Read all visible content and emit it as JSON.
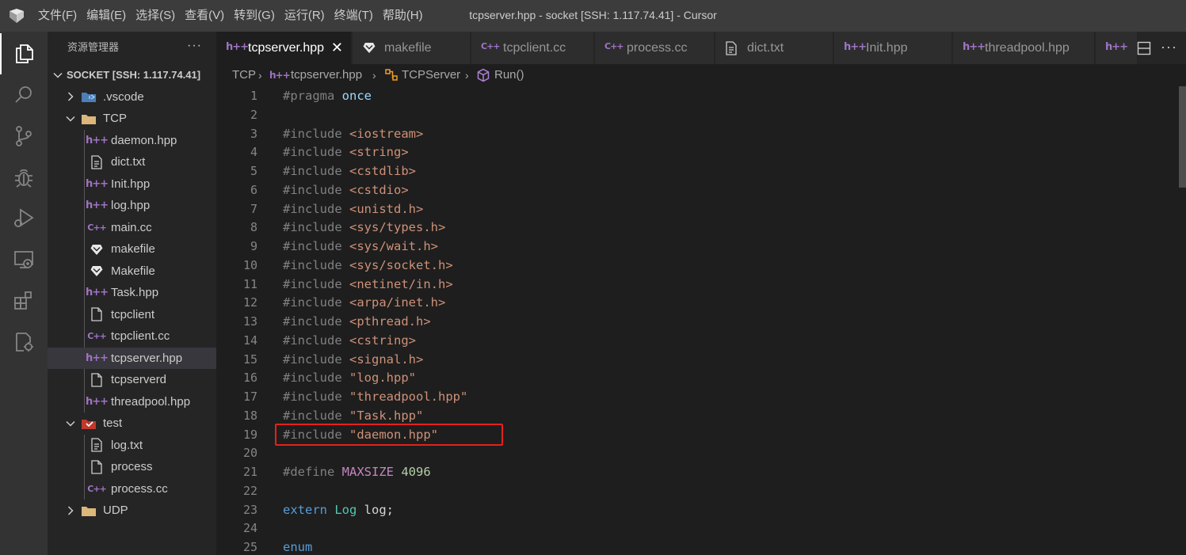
{
  "window": {
    "title": "tcpserver.hpp - socket [SSH: 1.117.74.41] - Cursor"
  },
  "menu": [
    "文件(F)",
    "编辑(E)",
    "选择(S)",
    "查看(V)",
    "转到(G)",
    "运行(R)",
    "终端(T)",
    "帮助(H)"
  ],
  "activity_bar": [
    {
      "name": "explorer",
      "icon": "files-icon",
      "active": true
    },
    {
      "name": "search",
      "icon": "search-icon",
      "active": false
    },
    {
      "name": "source-control",
      "icon": "source-control-icon",
      "active": false
    },
    {
      "name": "debug",
      "icon": "bug-icon",
      "active": false
    },
    {
      "name": "run-and-debug",
      "icon": "run-debug-icon",
      "active": false
    },
    {
      "name": "remote-explorer",
      "icon": "remote-explorer-icon",
      "active": false
    },
    {
      "name": "extensions",
      "icon": "extensions-icon",
      "active": false
    },
    {
      "name": "remote-settings",
      "icon": "settings-sync-icon",
      "active": false
    }
  ],
  "sidebar": {
    "title": "资源管理器",
    "more": "···",
    "root": "SOCKET [SSH: 1.117.74.41]",
    "tree": [
      {
        "label": ".vscode",
        "kind": "folder-vscode",
        "depth": 1,
        "expanded": false
      },
      {
        "label": "TCP",
        "kind": "folder",
        "depth": 1,
        "expanded": true
      },
      {
        "label": "daemon.hpp",
        "kind": "hpp",
        "depth": 2
      },
      {
        "label": "dict.txt",
        "kind": "txt",
        "depth": 2
      },
      {
        "label": "Init.hpp",
        "kind": "hpp",
        "depth": 2
      },
      {
        "label": "log.hpp",
        "kind": "hpp",
        "depth": 2
      },
      {
        "label": "main.cc",
        "kind": "cc",
        "depth": 2
      },
      {
        "label": "makefile",
        "kind": "make",
        "depth": 2
      },
      {
        "label": "Makefile",
        "kind": "make",
        "depth": 2
      },
      {
        "label": "Task.hpp",
        "kind": "hpp",
        "depth": 2
      },
      {
        "label": "tcpclient",
        "kind": "file",
        "depth": 2
      },
      {
        "label": "tcpclient.cc",
        "kind": "cc",
        "depth": 2
      },
      {
        "label": "tcpserver.hpp",
        "kind": "hpp",
        "depth": 2,
        "selected": true
      },
      {
        "label": "tcpserverd",
        "kind": "file",
        "depth": 2
      },
      {
        "label": "threadpool.hpp",
        "kind": "hpp",
        "depth": 2
      },
      {
        "label": "test",
        "kind": "folder-test",
        "depth": 1,
        "expanded": true
      },
      {
        "label": "log.txt",
        "kind": "txt",
        "depth": 2
      },
      {
        "label": "process",
        "kind": "file",
        "depth": 2
      },
      {
        "label": "process.cc",
        "kind": "cc",
        "depth": 2
      },
      {
        "label": "UDP",
        "kind": "folder",
        "depth": 1,
        "expanded": false
      }
    ]
  },
  "tabs": [
    {
      "label": "tcpserver.hpp",
      "kind": "hpp",
      "active": true,
      "close": "✕"
    },
    {
      "label": "makefile",
      "kind": "make",
      "active": false
    },
    {
      "label": "tcpclient.cc",
      "kind": "cc",
      "active": false
    },
    {
      "label": "process.cc",
      "kind": "cc",
      "active": false
    },
    {
      "label": "dict.txt",
      "kind": "txt",
      "active": false
    },
    {
      "label": "Init.hpp",
      "kind": "hpp",
      "active": false
    },
    {
      "label": "threadpool.hpp",
      "kind": "hpp",
      "active": false
    },
    {
      "label": "",
      "kind": "hpp",
      "active": false
    }
  ],
  "breadcrumb": {
    "folder": "TCP",
    "file": "tcpserver.hpp",
    "class": "TCPServer",
    "method": "Run()"
  },
  "editor": {
    "highlighted_line": 19,
    "lines": [
      [
        {
          "t": "#pragma ",
          "c": "t-comment"
        },
        {
          "t": "once",
          "c": "t-ppkw"
        }
      ],
      [],
      [
        {
          "t": "#include ",
          "c": "t-comment"
        },
        {
          "t": "<iostream>",
          "c": "t-str"
        }
      ],
      [
        {
          "t": "#include ",
          "c": "t-comment"
        },
        {
          "t": "<string>",
          "c": "t-str"
        }
      ],
      [
        {
          "t": "#include ",
          "c": "t-comment"
        },
        {
          "t": "<cstdlib>",
          "c": "t-str"
        }
      ],
      [
        {
          "t": "#include ",
          "c": "t-comment"
        },
        {
          "t": "<cstdio>",
          "c": "t-str"
        }
      ],
      [
        {
          "t": "#include ",
          "c": "t-comment"
        },
        {
          "t": "<unistd.h>",
          "c": "t-str"
        }
      ],
      [
        {
          "t": "#include ",
          "c": "t-comment"
        },
        {
          "t": "<sys/types.h>",
          "c": "t-str"
        }
      ],
      [
        {
          "t": "#include ",
          "c": "t-comment"
        },
        {
          "t": "<sys/wait.h>",
          "c": "t-str"
        }
      ],
      [
        {
          "t": "#include ",
          "c": "t-comment"
        },
        {
          "t": "<sys/socket.h>",
          "c": "t-str"
        }
      ],
      [
        {
          "t": "#include ",
          "c": "t-comment"
        },
        {
          "t": "<netinet/in.h>",
          "c": "t-str"
        }
      ],
      [
        {
          "t": "#include ",
          "c": "t-comment"
        },
        {
          "t": "<arpa/inet.h>",
          "c": "t-str"
        }
      ],
      [
        {
          "t": "#include ",
          "c": "t-comment"
        },
        {
          "t": "<pthread.h>",
          "c": "t-str"
        }
      ],
      [
        {
          "t": "#include ",
          "c": "t-comment"
        },
        {
          "t": "<cstring>",
          "c": "t-str"
        }
      ],
      [
        {
          "t": "#include ",
          "c": "t-comment"
        },
        {
          "t": "<signal.h>",
          "c": "t-str"
        }
      ],
      [
        {
          "t": "#include ",
          "c": "t-comment"
        },
        {
          "t": "\"log.hpp\"",
          "c": "t-str"
        }
      ],
      [
        {
          "t": "#include ",
          "c": "t-comment"
        },
        {
          "t": "\"threadpool.hpp\"",
          "c": "t-str"
        }
      ],
      [
        {
          "t": "#include ",
          "c": "t-comment"
        },
        {
          "t": "\"Task.hpp\"",
          "c": "t-str"
        }
      ],
      [
        {
          "t": "#include ",
          "c": "t-comment"
        },
        {
          "t": "\"daemon.hpp\"",
          "c": "t-str"
        }
      ],
      [],
      [
        {
          "t": "#define ",
          "c": "t-comment"
        },
        {
          "t": "MAXSIZE",
          "c": "t-macro"
        },
        {
          "t": " ",
          "c": "t-plain"
        },
        {
          "t": "4096",
          "c": "t-num"
        }
      ],
      [],
      [
        {
          "t": "extern ",
          "c": "t-kw"
        },
        {
          "t": "Log",
          "c": "t-type"
        },
        {
          "t": " log;",
          "c": "t-plain"
        }
      ],
      [],
      [
        {
          "t": "enum",
          "c": "t-kw"
        }
      ]
    ]
  }
}
